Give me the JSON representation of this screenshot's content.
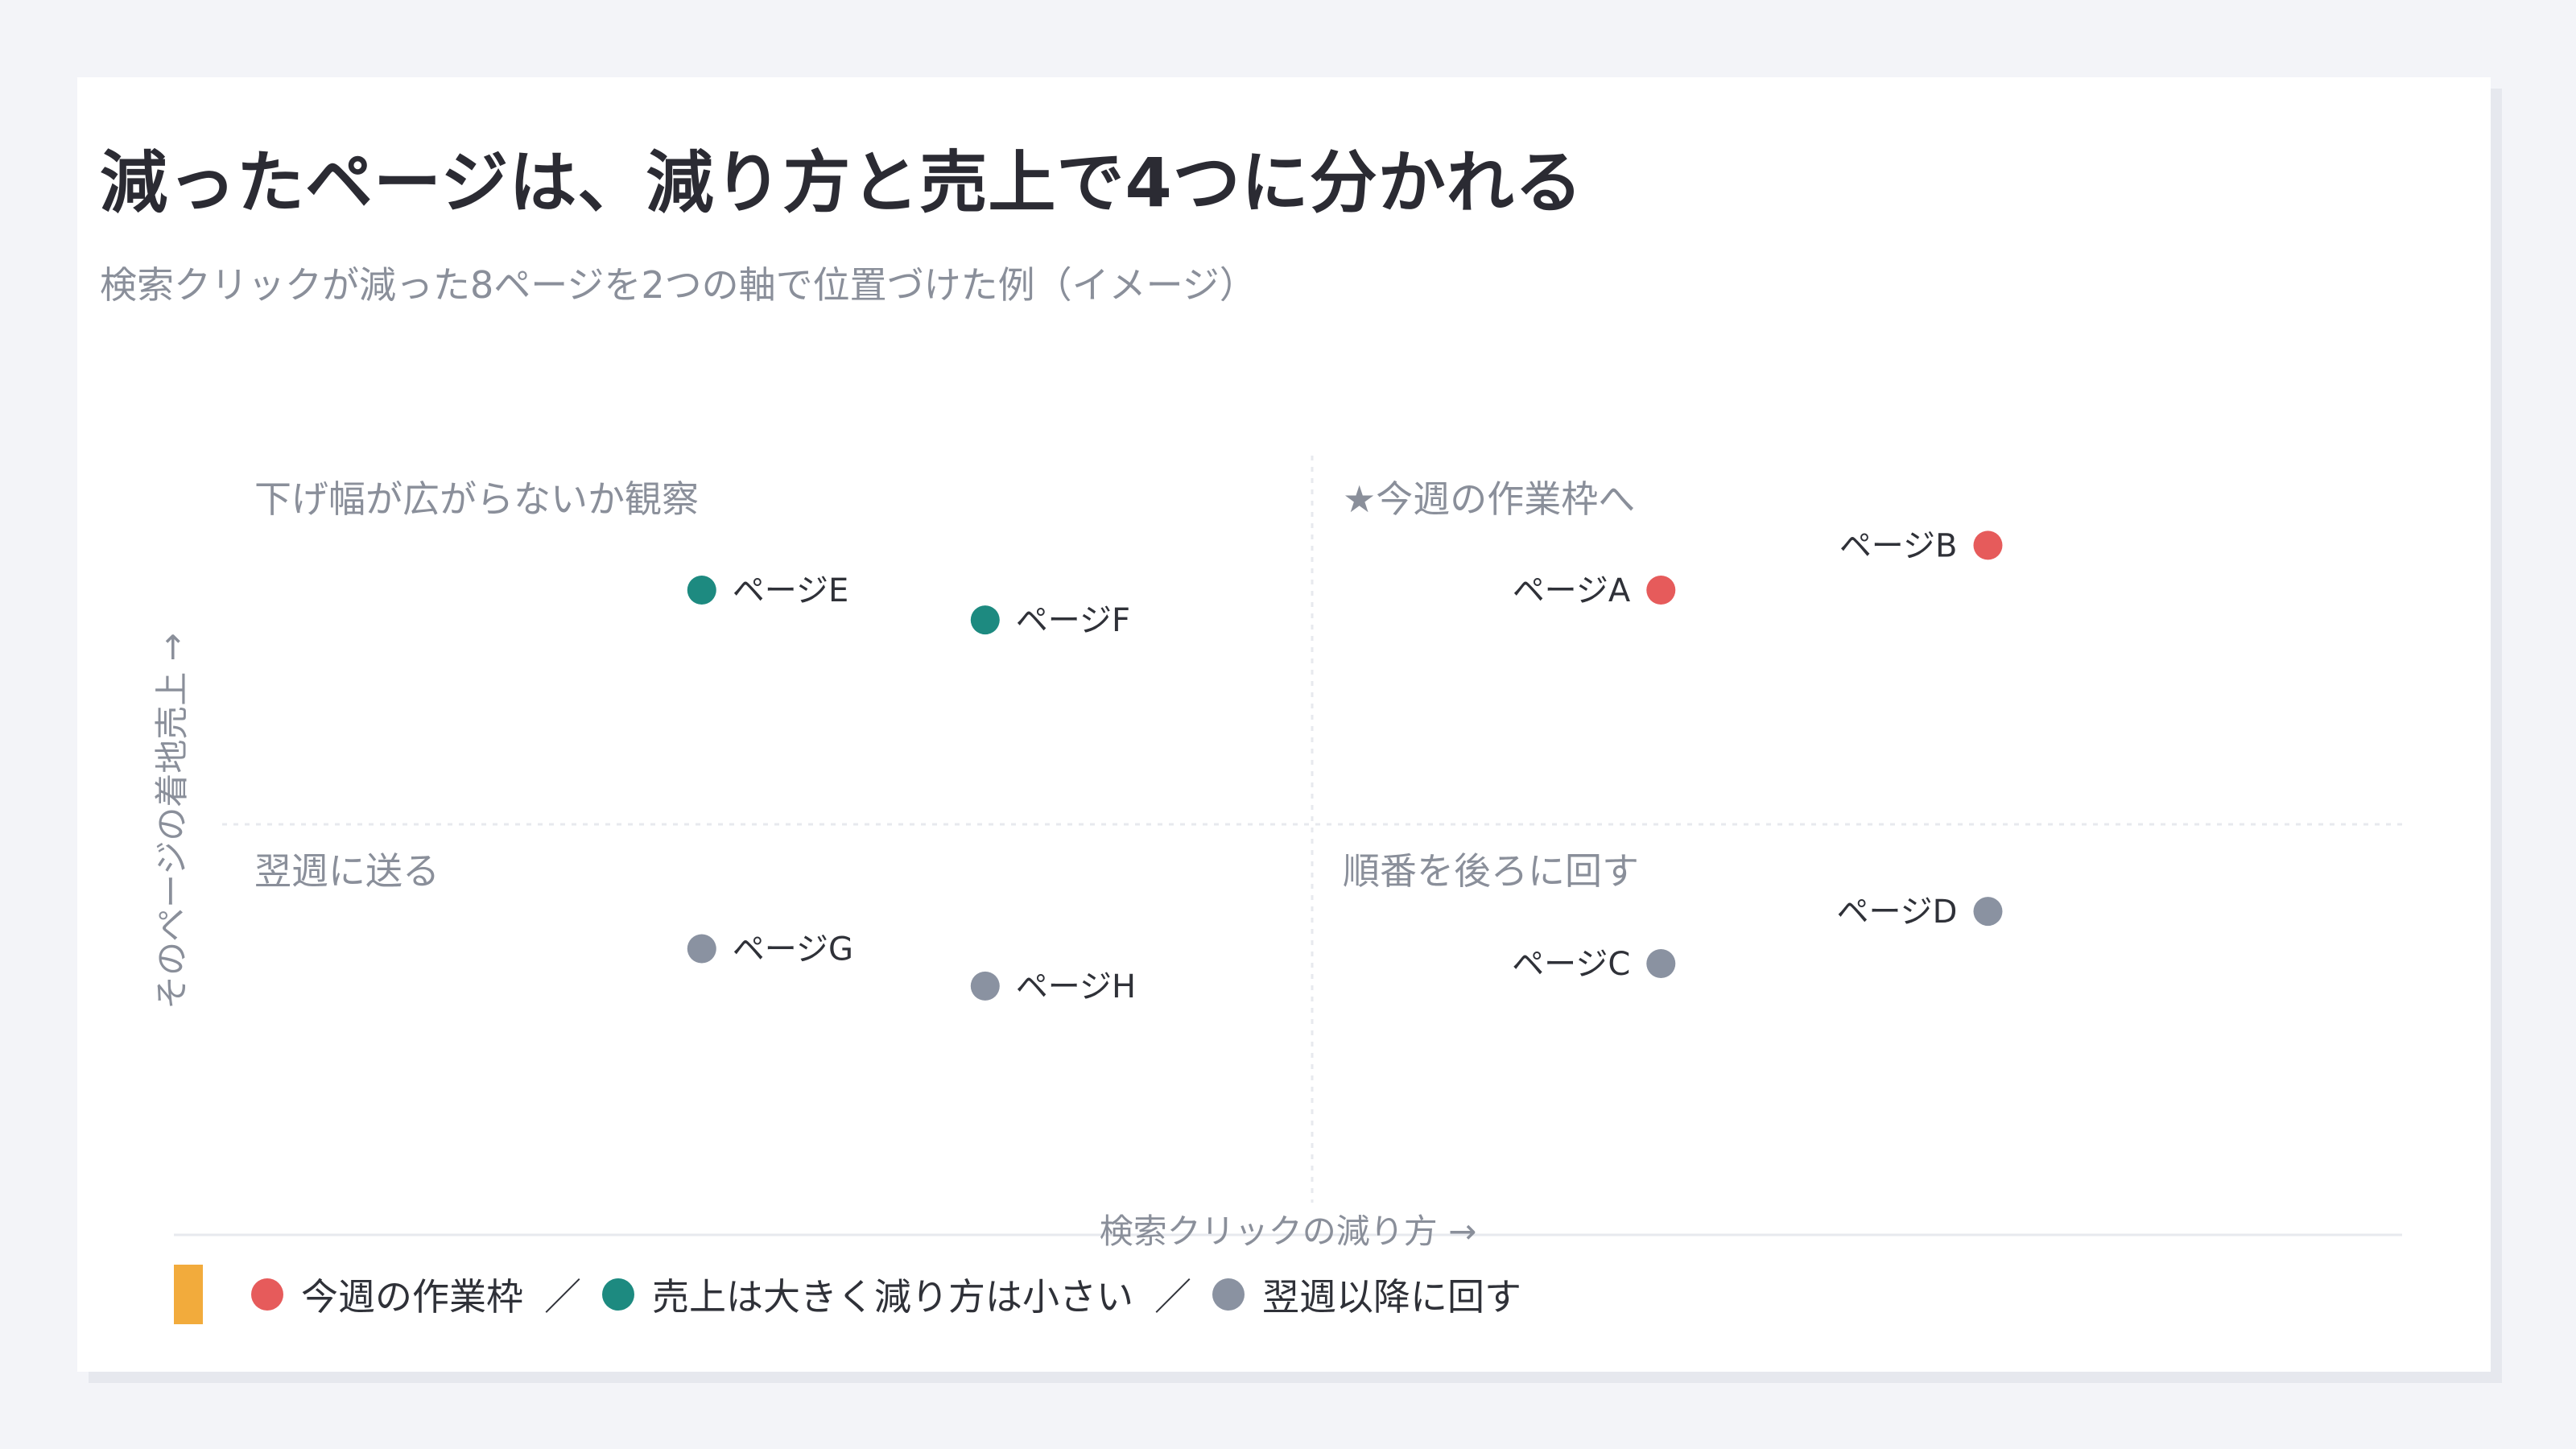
{
  "title": "減ったページは、減り方と売上で4つに分かれる",
  "subtitle": "検索クリックが減った8ページを2つの軸で位置づけた例（イメージ）",
  "chart_data": {
    "type": "scatter",
    "xlabel": "検索クリックの減り方 →",
    "ylabel": "そのページの着地売上 →",
    "xlim": [
      0,
      100
    ],
    "ylim": [
      0,
      100
    ],
    "grid": "center-divider",
    "quadrants": {
      "top_left": "下げ幅が広がらないか観察",
      "top_right": "★今週の作業枠へ",
      "bottom_left": "翌週に送る",
      "bottom_right": "順番を後ろに回す"
    },
    "points": [
      {
        "label": "ページA",
        "x": 66,
        "y": 18,
        "group": "this_week",
        "label_side": "left"
      },
      {
        "label": "ページB",
        "x": 81,
        "y": 12,
        "group": "this_week",
        "label_side": "left"
      },
      {
        "label": "ページC",
        "x": 66,
        "y": 68,
        "group": "later",
        "label_side": "left"
      },
      {
        "label": "ページD",
        "x": 81,
        "y": 61,
        "group": "later",
        "label_side": "left"
      },
      {
        "label": "ページE",
        "x": 22,
        "y": 18,
        "group": "sales_big",
        "label_side": "right"
      },
      {
        "label": "ページF",
        "x": 35,
        "y": 22,
        "group": "sales_big",
        "label_side": "right"
      },
      {
        "label": "ページG",
        "x": 22,
        "y": 66,
        "group": "later",
        "label_side": "right"
      },
      {
        "label": "ページH",
        "x": 35,
        "y": 71,
        "group": "later",
        "label_side": "right"
      }
    ],
    "groups": {
      "this_week": {
        "color": "#e65b5b"
      },
      "sales_big": {
        "color": "#1d8a80"
      },
      "later": {
        "color": "#8a92a1"
      }
    }
  },
  "legend": {
    "items": [
      {
        "name": "今週の作業枠",
        "color": "#e65b5b"
      },
      {
        "name": "売上は大きく減り方は小さい",
        "color": "#1d8a80"
      },
      {
        "name": "翌週以降に回す",
        "color": "#8a92a1"
      }
    ],
    "separator": "／",
    "accent_color": "#f2ab3c"
  }
}
